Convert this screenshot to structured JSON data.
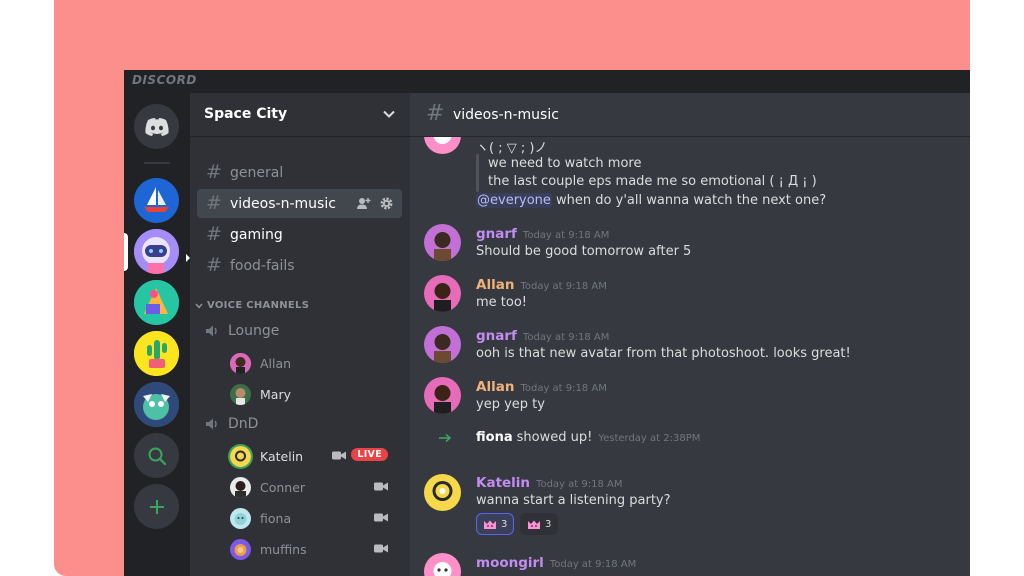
{
  "app": {
    "brand": "DISCORD"
  },
  "server": {
    "name": "Space City"
  },
  "channels": [
    {
      "name": "general",
      "state": "normal"
    },
    {
      "name": "videos-n-music",
      "state": "active"
    },
    {
      "name": "gaming",
      "state": "unread"
    },
    {
      "name": "food-fails",
      "state": "normal"
    }
  ],
  "voice": {
    "category": "VOICE CHANNELS",
    "channels": [
      {
        "name": "Lounge",
        "users": [
          "Allan",
          "Mary"
        ]
      },
      {
        "name": "DnD",
        "users": [
          "Katelin",
          "Conner",
          "fiona",
          "muffins"
        ]
      }
    ],
    "live_label": "LIVE"
  },
  "chat": {
    "channel": "videos-n-music",
    "messages": [
      {
        "lines": [
          "ヽ( ; ▽ ; )ノ",
          "we need to watch more",
          "the last couple eps made me so emotional ( ¡ Д ¡ )"
        ],
        "mention": "@everyone",
        "after_mention": " when do y'all wanna watch the next one?"
      },
      {
        "author": "gnarf",
        "time": "Today at 9:18 AM",
        "text": "Should be good tomorrow after 5"
      },
      {
        "author": "Allan",
        "time": "Today at 9:18 AM",
        "text": "me too!"
      },
      {
        "author": "gnarf",
        "time": "Today at 9:18 AM",
        "text": "ooh is that new avatar from that photoshoot. looks great!"
      },
      {
        "author": "Allan",
        "time": "Today at 9:18 AM",
        "text": "yep yep ty"
      },
      {
        "author": "Katelin",
        "time": "Today at 9:18 AM",
        "text": "wanna start a listening party?"
      },
      {
        "author": "moongirl",
        "time": "Today at 9:18 AM",
        "text": ""
      }
    ],
    "system": {
      "name": "fiona",
      "text": "showed up!",
      "time": "Yesterday at 2:38PM"
    },
    "reactions": [
      {
        "count": "3"
      },
      {
        "count": "3"
      }
    ]
  },
  "colors": {
    "accent": "#5865f2",
    "author_purple": "#c28cf2",
    "author_orange": "#f0b27a",
    "live_red": "#ed4245",
    "frame_bg": "#fc8f8c"
  },
  "icons": [
    "discord-logo-icon",
    "hash-icon",
    "chevron-down-icon",
    "add-member-icon",
    "gear-icon",
    "speaker-icon",
    "camera-icon",
    "search-icon",
    "plus-icon",
    "arrow-right-icon"
  ]
}
